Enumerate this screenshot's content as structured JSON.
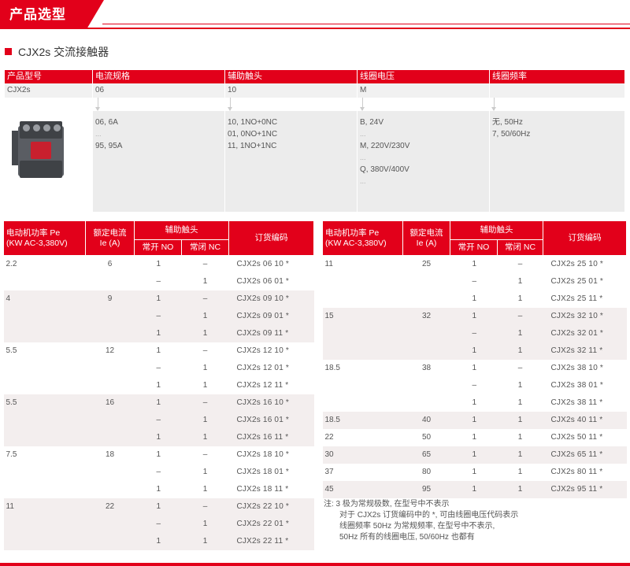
{
  "header": {
    "title": "产品选型"
  },
  "subtitle": "CJX2s 交流接触器",
  "selection": {
    "headers": [
      "产品型号",
      "电流规格",
      "辅助触头",
      "线圈电压",
      "线圈频率"
    ],
    "values": [
      "CJX2s",
      "06",
      "10",
      "M",
      ""
    ],
    "options": {
      "current": [
        "06, 6A",
        "...",
        "95, 95A"
      ],
      "aux": [
        "10, 1NO+0NC",
        "01, 0NO+1NC",
        "11, 1NO+1NC"
      ],
      "voltage": [
        "B, 24V",
        "...",
        "M, 220V/230V",
        "...",
        "Q, 380V/400V",
        "..."
      ],
      "freq": [
        "无, 50Hz",
        "7, 50/60Hz"
      ]
    }
  },
  "table_headers": {
    "power": "电动机功率 Pe",
    "power_unit": "(KW AC-3,380V)",
    "current": "额定电流",
    "current_unit": "Ie (A)",
    "aux": "辅助触头",
    "no": "常开 NO",
    "nc": "常闭 NC",
    "code": "订货编码"
  },
  "left_rows": [
    {
      "power": "2.2",
      "current": "6",
      "no": "1",
      "nc": "–",
      "code": "CJX2s 06 10 *",
      "shade": false
    },
    {
      "power": "",
      "current": "",
      "no": "–",
      "nc": "1",
      "code": "CJX2s 06 01 *",
      "shade": false
    },
    {
      "power": "4",
      "current": "9",
      "no": "1",
      "nc": "–",
      "code": "CJX2s 09 10 *",
      "shade": true
    },
    {
      "power": "",
      "current": "",
      "no": "–",
      "nc": "1",
      "code": "CJX2s 09 01 *",
      "shade": true
    },
    {
      "power": "",
      "current": "",
      "no": "1",
      "nc": "1",
      "code": "CJX2s 09 11 *",
      "shade": true
    },
    {
      "power": "5.5",
      "current": "12",
      "no": "1",
      "nc": "–",
      "code": "CJX2s 12 10 *",
      "shade": false
    },
    {
      "power": "",
      "current": "",
      "no": "–",
      "nc": "1",
      "code": "CJX2s 12 01 *",
      "shade": false
    },
    {
      "power": "",
      "current": "",
      "no": "1",
      "nc": "1",
      "code": "CJX2s 12 11 *",
      "shade": false
    },
    {
      "power": "5.5",
      "current": "16",
      "no": "1",
      "nc": "–",
      "code": "CJX2s 16 10 *",
      "shade": true
    },
    {
      "power": "",
      "current": "",
      "no": "–",
      "nc": "1",
      "code": "CJX2s 16 01 *",
      "shade": true
    },
    {
      "power": "",
      "current": "",
      "no": "1",
      "nc": "1",
      "code": "CJX2s 16 11 *",
      "shade": true
    },
    {
      "power": "7.5",
      "current": "18",
      "no": "1",
      "nc": "–",
      "code": "CJX2s 18 10 *",
      "shade": false
    },
    {
      "power": "",
      "current": "",
      "no": "–",
      "nc": "1",
      "code": "CJX2s 18 01 *",
      "shade": false
    },
    {
      "power": "",
      "current": "",
      "no": "1",
      "nc": "1",
      "code": "CJX2s 18 11 *",
      "shade": false
    },
    {
      "power": "11",
      "current": "22",
      "no": "1",
      "nc": "–",
      "code": "CJX2s 22 10 *",
      "shade": true
    },
    {
      "power": "",
      "current": "",
      "no": "–",
      "nc": "1",
      "code": "CJX2s 22 01 *",
      "shade": true
    },
    {
      "power": "",
      "current": "",
      "no": "1",
      "nc": "1",
      "code": "CJX2s 22 11 *",
      "shade": true
    }
  ],
  "right_rows": [
    {
      "power": "11",
      "current": "25",
      "no": "1",
      "nc": "–",
      "code": "CJX2s 25 10 *",
      "shade": false
    },
    {
      "power": "",
      "current": "",
      "no": "–",
      "nc": "1",
      "code": "CJX2s 25 01 *",
      "shade": false
    },
    {
      "power": "",
      "current": "",
      "no": "1",
      "nc": "1",
      "code": "CJX2s 25 11 *",
      "shade": false
    },
    {
      "power": "15",
      "current": "32",
      "no": "1",
      "nc": "–",
      "code": "CJX2s 32 10 *",
      "shade": true
    },
    {
      "power": "",
      "current": "",
      "no": "–",
      "nc": "1",
      "code": "CJX2s 32 01 *",
      "shade": true
    },
    {
      "power": "",
      "current": "",
      "no": "1",
      "nc": "1",
      "code": "CJX2s 32 11 *",
      "shade": true
    },
    {
      "power": "18.5",
      "current": "38",
      "no": "1",
      "nc": "–",
      "code": "CJX2s 38 10 *",
      "shade": false
    },
    {
      "power": "",
      "current": "",
      "no": "–",
      "nc": "1",
      "code": "CJX2s 38 01 *",
      "shade": false
    },
    {
      "power": "",
      "current": "",
      "no": "1",
      "nc": "1",
      "code": "CJX2s 38 11 *",
      "shade": false
    },
    {
      "power": "18.5",
      "current": "40",
      "no": "1",
      "nc": "1",
      "code": "CJX2s 40 11 *",
      "shade": true
    },
    {
      "power": "22",
      "current": "50",
      "no": "1",
      "nc": "1",
      "code": "CJX2s 50 11 *",
      "shade": false
    },
    {
      "power": "30",
      "current": "65",
      "no": "1",
      "nc": "1",
      "code": "CJX2s 65 11 *",
      "shade": true
    },
    {
      "power": "37",
      "current": "80",
      "no": "1",
      "nc": "1",
      "code": "CJX2s 80 11 *",
      "shade": false
    },
    {
      "power": "45",
      "current": "95",
      "no": "1",
      "nc": "1",
      "code": "CJX2s 95 11 *",
      "shade": true
    }
  ],
  "note": [
    "注: 3 极为常规极数, 在型号中不表示",
    "对于 CJX2s 订货编码中的 *, 可由线圈电压代码表示",
    "线圈频率 50Hz 为常规频率, 在型号中不表示,",
    "50Hz 所有的线圈电压, 50/60Hz 也都有"
  ],
  "colors": {
    "brand": "#e2001a",
    "shade": "#f3eeee",
    "panel": "#ececec"
  }
}
